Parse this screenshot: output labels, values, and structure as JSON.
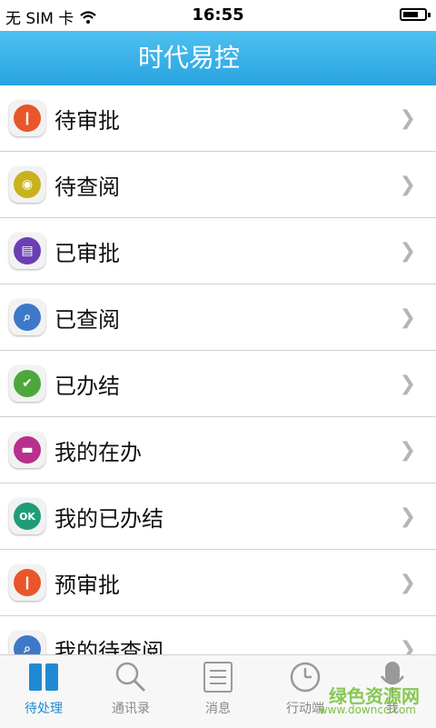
{
  "status": {
    "carrier": "无 SIM 卡",
    "time": "16:55"
  },
  "nav": {
    "title": "时代易控"
  },
  "items": [
    {
      "label": "待审批",
      "icon": "approve-pending-icon",
      "color": "#e8562a"
    },
    {
      "label": "待查阅",
      "icon": "review-pending-icon",
      "color": "#c8b31c"
    },
    {
      "label": "已审批",
      "icon": "approved-icon",
      "color": "#6b3fb5"
    },
    {
      "label": "已查阅",
      "icon": "reviewed-search-icon",
      "color": "#3d79c8"
    },
    {
      "label": "已办结",
      "icon": "completed-check-icon",
      "color": "#4ca83a"
    },
    {
      "label": "我的在办",
      "icon": "my-in-progress-icon",
      "color": "#b8308d"
    },
    {
      "label": "我的已办结",
      "icon": "my-completed-ok-icon",
      "color": "#1f9d77"
    },
    {
      "label": "预审批",
      "icon": "pre-approve-icon",
      "color": "#e8562a"
    },
    {
      "label": "我的待查阅",
      "icon": "my-review-pending-icon",
      "color": "#3d79c8"
    }
  ],
  "tabs": [
    {
      "label": "待处理",
      "icon": "pending-tab-icon",
      "active": true
    },
    {
      "label": "通讯录",
      "icon": "search-tab-icon",
      "active": false
    },
    {
      "label": "消息",
      "icon": "message-list-icon",
      "active": false
    },
    {
      "label": "行动端",
      "icon": "clock-icon",
      "active": false
    },
    {
      "label": "我",
      "icon": "mic-icon",
      "active": false
    }
  ],
  "watermark": {
    "text": "绿色资源网",
    "url": "www.downcc.com"
  },
  "colors": {
    "accent": "#29a3e0",
    "tab_active": "#1f8ad4"
  }
}
